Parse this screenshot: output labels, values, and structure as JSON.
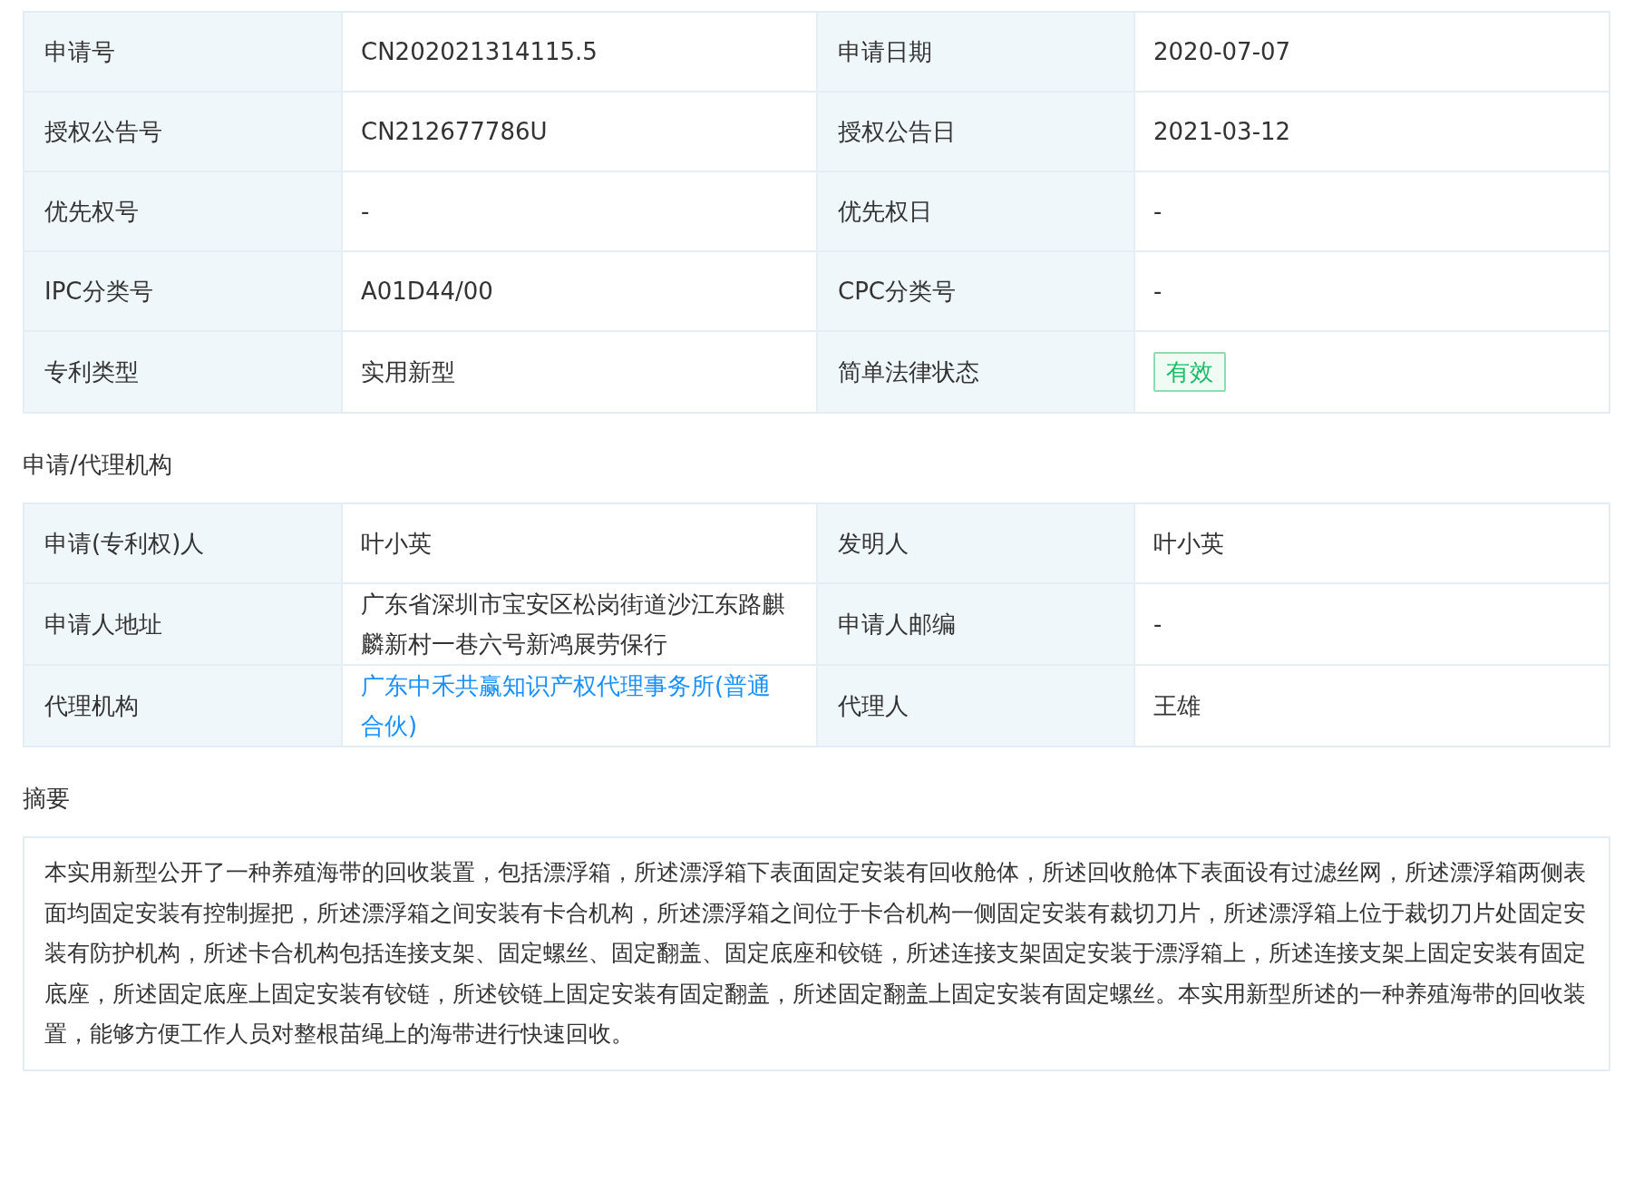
{
  "sections": [
    {
      "rows": [
        [
          {
            "label": "申请号",
            "value": "CN202021314115.5",
            "kind": "text"
          },
          {
            "label": "申请日期",
            "value": "2020-07-07",
            "kind": "text"
          }
        ],
        [
          {
            "label": "授权公告号",
            "value": "CN212677786U",
            "kind": "text"
          },
          {
            "label": "授权公告日",
            "value": "2021-03-12",
            "kind": "text"
          }
        ],
        [
          {
            "label": "优先权号",
            "value": "-",
            "kind": "text"
          },
          {
            "label": "优先权日",
            "value": "-",
            "kind": "text"
          }
        ],
        [
          {
            "label": "IPC分类号",
            "value": "A01D44/00",
            "kind": "text"
          },
          {
            "label": "CPC分类号",
            "value": "-",
            "kind": "text"
          }
        ],
        [
          {
            "label": "专利类型",
            "value": "实用新型",
            "kind": "text"
          },
          {
            "label": "简单法律状态",
            "value": "有效",
            "kind": "badge"
          }
        ]
      ]
    },
    {
      "heading": "申请/代理机构",
      "rows": [
        [
          {
            "label": "申请(专利权)人",
            "value": "叶小英",
            "kind": "text"
          },
          {
            "label": "发明人",
            "value": "叶小英",
            "kind": "text"
          }
        ],
        [
          {
            "label": "申请人地址",
            "value": "广东省深圳市宝安区松岗街道沙江东路麒麟新村一巷六号新鸿展劳保行",
            "kind": "text"
          },
          {
            "label": "申请人邮编",
            "value": "-",
            "kind": "text"
          }
        ],
        [
          {
            "label": "代理机构",
            "value": "广东中禾共赢知识产权代理事务所(普通合伙)",
            "kind": "link"
          },
          {
            "label": "代理人",
            "value": "王雄",
            "kind": "text"
          }
        ]
      ]
    }
  ],
  "abstract": {
    "heading": "摘要",
    "text": "本实用新型公开了一种养殖海带的回收装置，包括漂浮箱，所述漂浮箱下表面固定安装有回收舱体，所述回收舱体下表面设有过滤丝网，所述漂浮箱两侧表面均固定安装有控制握把，所述漂浮箱之间安装有卡合机构，所述漂浮箱之间位于卡合机构一侧固定安装有裁切刀片，所述漂浮箱上位于裁切刀片处固定安装有防护机构，所述卡合机构包括连接支架、固定螺丝、固定翻盖、固定底座和铰链，所述连接支架固定安装于漂浮箱上，所述连接支架上固定安装有固定底座，所述固定底座上固定安装有铰链，所述铰链上固定安装有固定翻盖，所述固定翻盖上固定安装有固定螺丝。本实用新型所述的一种养殖海带的回收装置，能够方便工作人员对整根苗绳上的海带进行快速回收。"
  }
}
